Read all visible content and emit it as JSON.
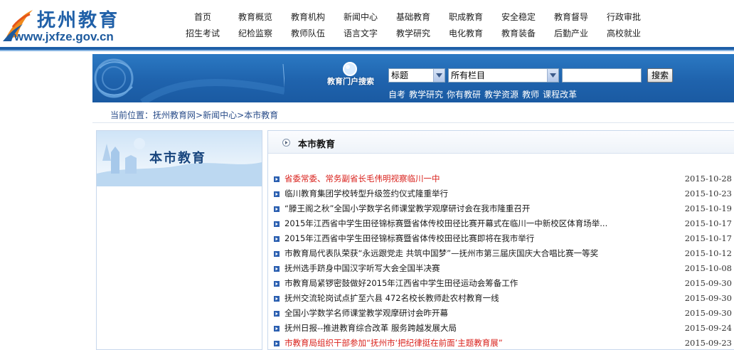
{
  "header": {
    "logo_title": "抚州教育",
    "logo_url": "www.jxfze.gov.cn",
    "nav_row1": [
      "首页",
      "教育概览",
      "教育机构",
      "新闻中心",
      "基础教育",
      "职成教育",
      "安全稳定",
      "教育督导",
      "行政审批"
    ],
    "nav_row2": [
      "招生考试",
      "纪检监察",
      "教师队伍",
      "语言文字",
      "教学研究",
      "电化教育",
      "教育装备",
      "后勤产业",
      "高校就业"
    ],
    "accent_color": "#1e5fa8"
  },
  "search": {
    "portal_label": "教育门户搜索",
    "type_select": "标题",
    "column_select": "所有栏目",
    "query": "",
    "button_label": "搜索",
    "quick_links": [
      "自考",
      "教学研究",
      "你有教研",
      "教学资源",
      "教师",
      "课程改革"
    ]
  },
  "breadcrumb": {
    "prefix": "当前位置：",
    "items": [
      "抚州教育网",
      "新闻中心",
      "本市教育"
    ],
    "separator": ">"
  },
  "sidebar": {
    "title": "本市教育"
  },
  "main": {
    "section_title": "本市教育",
    "news": [
      {
        "title": "省委常委、常务副省长毛伟明视察临川一中",
        "date": "2015-10-28",
        "hot": true
      },
      {
        "title": "临川教育集团学校转型升级签约仪式隆重举行",
        "date": "2015-10-23",
        "hot": false
      },
      {
        "title": "“滕王阁之秋”全国小学数学名师课堂教学观摩研讨会在我市隆重召开",
        "date": "2015-10-19",
        "hot": false
      },
      {
        "title": "2015年江西省中学生田径锦标赛暨省体传校田径比赛开幕式在临川一中新校区体育场举...",
        "date": "2015-10-17",
        "hot": false
      },
      {
        "title": "2015年江西省中学生田径锦标赛暨省体传校田径比赛即将在我市举行",
        "date": "2015-10-17",
        "hot": false
      },
      {
        "title": "市教育局代表队荣获“永远跟党走 共筑中国梦”—抚州市第三届庆国庆大合唱比赛一等奖",
        "date": "2015-10-12",
        "hot": false
      },
      {
        "title": "抚州选手跻身中国汉字听写大会全国半决赛",
        "date": "2015-10-08",
        "hot": false
      },
      {
        "title": "市教育局紧锣密鼓做好2015年江西省中学生田径运动会筹备工作",
        "date": "2015-09-30",
        "hot": false
      },
      {
        "title": "抚州交流轮岗试点扩至六县  472名校长教师赴农村教育一线",
        "date": "2015-09-30",
        "hot": false
      },
      {
        "title": "全国小学数学名师课堂教学观摩研讨会昨开幕",
        "date": "2015-09-30",
        "hot": false
      },
      {
        "title": "抚州日报--推进教育综合改革 服务跨越发展大局",
        "date": "2015-09-24",
        "hot": false
      },
      {
        "title": "市教育局组织干部参加“抚州市‘把纪律挺在前面’主题教育展”",
        "date": "2015-09-23",
        "hot": true
      }
    ]
  }
}
